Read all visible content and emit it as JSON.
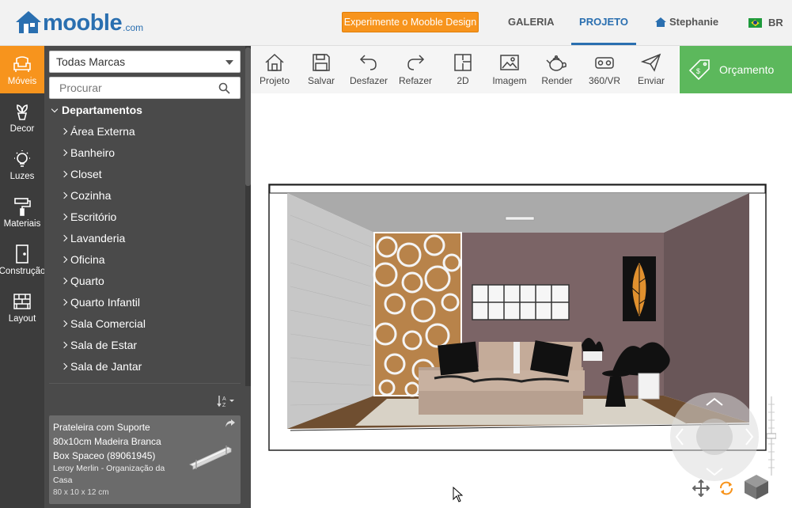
{
  "header": {
    "logo_word": "mooble",
    "logo_domain": ".com",
    "promo_button": "Experimente o Mooble Design",
    "nav_galeria": "GALERIA",
    "nav_projeto": "PROJETO",
    "user_name": "Stephanie",
    "language": "BR"
  },
  "rail": {
    "items": [
      {
        "label": "Móveis",
        "icon": "armchair-icon",
        "active": true
      },
      {
        "label": "Decor",
        "icon": "plant-icon"
      },
      {
        "label": "Luzes",
        "icon": "lightbulb-icon"
      },
      {
        "label": "Materiais",
        "icon": "paint-roller-icon"
      },
      {
        "label": "Construção",
        "icon": "door-icon"
      },
      {
        "label": "Layout",
        "icon": "brick-wall-icon"
      }
    ]
  },
  "catalog": {
    "brand_select": "Todas Marcas",
    "search_placeholder": "Procurar",
    "tree_title": "Departamentos",
    "departments": [
      "Área Externa",
      "Banheiro",
      "Closet",
      "Cozinha",
      "Escritório",
      "Lavanderia",
      "Oficina",
      "Quarto",
      "Quarto Infantil",
      "Sala Comercial",
      "Sala de Estar",
      "Sala de Jantar"
    ],
    "sort_icon": "sort-alpha-icon",
    "product": {
      "title": "Prateleira com Suporte 80x10cm Madeira Branca Box Spaceo (89061945)",
      "brand": "Leroy Merlin - Organização da Casa",
      "dimensions": "80 x 10 x 12 cm"
    }
  },
  "toolbar": {
    "tools": [
      {
        "label": "Projeto",
        "icon": "house-icon"
      },
      {
        "label": "Salvar",
        "icon": "floppy-icon"
      },
      {
        "label": "Desfazer",
        "icon": "undo-icon"
      },
      {
        "label": "Refazer",
        "icon": "redo-icon"
      },
      {
        "label": "2D",
        "icon": "floorplan-icon"
      },
      {
        "label": "Imagem",
        "icon": "image-icon"
      },
      {
        "label": "Render",
        "icon": "teapot-icon"
      },
      {
        "label": "360/VR",
        "icon": "vr-headset-icon"
      },
      {
        "label": "Enviar",
        "icon": "paper-plane-icon"
      }
    ],
    "budget_button": "Orçamento"
  },
  "colors": {
    "accent_orange": "#f7941d",
    "brand_blue": "#2a6fb0",
    "budget_green": "#5cb85c",
    "rail_dark": "#3c3c3c",
    "panel_dark": "#4a4a4a"
  }
}
